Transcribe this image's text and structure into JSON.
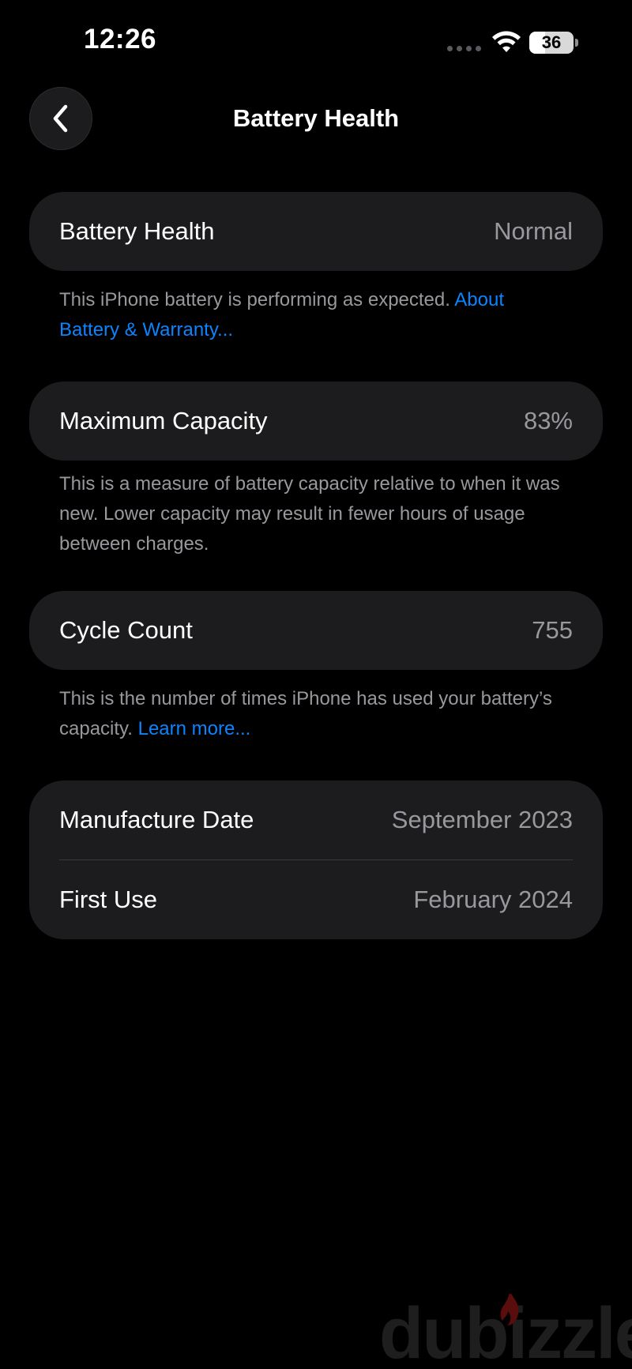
{
  "status_bar": {
    "time": "12:26",
    "battery_level": "36",
    "battery_fraction": 0.36
  },
  "nav": {
    "title": "Battery Health",
    "back_icon": "chevron-left-icon"
  },
  "battery_health": {
    "label": "Battery Health",
    "value": "Normal",
    "footnote_text": "This iPhone battery is performing as expected. ",
    "footnote_link": "About Battery & Warranty..."
  },
  "maximum_capacity": {
    "label": "Maximum Capacity",
    "value": "83%",
    "footnote_text": "This is a measure of battery capacity relative to when it was new. Lower capacity may result in fewer hours of usage between charges."
  },
  "cycle_count": {
    "label": "Cycle Count",
    "value": "755",
    "footnote_text": "This is the number of times iPhone has used your battery’s capacity. ",
    "footnote_link": "Learn more..."
  },
  "dates": {
    "manufacture_label": "Manufacture Date",
    "manufacture_value": "September 2023",
    "first_use_label": "First Use",
    "first_use_value": "February 2024"
  },
  "watermark": {
    "text": "dubizzle"
  },
  "colors": {
    "background": "#000000",
    "card": "#1c1c1e",
    "secondary_text": "#98989d",
    "link": "#0a84ff",
    "watermark_flame": "#e00000"
  }
}
